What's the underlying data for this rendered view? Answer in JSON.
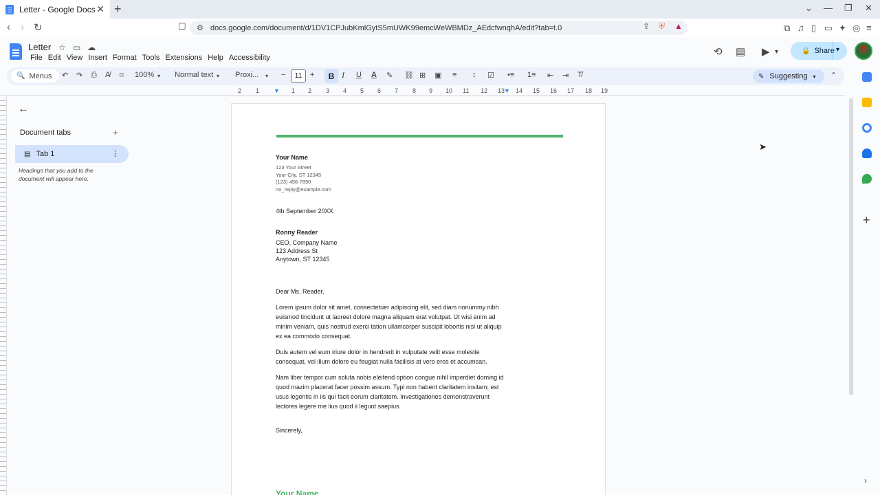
{
  "browser": {
    "tab_title": "Letter - Google Docs",
    "tab_close": "✕",
    "new_tab": "+",
    "url": "docs.google.com/document/d/1DV1CPJubKmlGytS5mUWK99emcWeWBMDz_AEdcfwnqhA/edit?tab=t.0",
    "window_controls": [
      "⌄",
      "—",
      "❐",
      "✕"
    ]
  },
  "docs_header": {
    "title": "Letter",
    "menus": [
      "File",
      "Edit",
      "View",
      "Insert",
      "Format",
      "Tools",
      "Extensions",
      "Help",
      "Accessibility"
    ],
    "share_label": "Share"
  },
  "toolbar": {
    "search_menus": "Menus",
    "zoom": "100%",
    "style": "Normal text",
    "font": "Proxi...",
    "font_size": "11",
    "bold": "B",
    "italic": "I",
    "underline": "U",
    "mode": "Suggesting"
  },
  "ruler_numbers": [
    "2",
    "1",
    "1",
    "2",
    "3",
    "4",
    "5",
    "6",
    "7",
    "8",
    "9",
    "10",
    "11",
    "12",
    "13",
    "14",
    "15",
    "16",
    "17",
    "18",
    "19"
  ],
  "side_panel": {
    "heading": "Document tabs",
    "tab_label": "Tab 1",
    "hint": "Headings that you add to the document will appear here."
  },
  "document": {
    "sender_name": "Your Name",
    "sender_lines": [
      "123 Your Street",
      "Your City, ST 12345",
      "(123) 456-7890",
      "no_reply@example.com"
    ],
    "date": "4th September 20XX",
    "recipient_name": "Ronny Reader",
    "recipient_lines": [
      "CEO, Company Name",
      "123 Address St",
      "Anytown, ST 12345"
    ],
    "salutation": "Dear Ms. Reader,",
    "paragraphs": [
      "Lorem ipsum dolor sit amet, consectetuer adipiscing elit, sed diam nonummy nibh euismod tincidunt ut laoreet dolore magna aliquam erat volutpat. Ut wisi enim ad minim veniam, quis nostrud exerci tation ullamcorper suscipit lobortis nisl ut aliquip ex ea commodo consequat.",
      "Duis autem vel eum iriure dolor in hendrerit in vulputate velit esse molestie consequat, vel illum dolore eu feugiat nulla facilisis at vero eros et accumsan.",
      "Nam liber tempor cum soluta nobis eleifend option congue nihil imperdiet doming id quod mazim placerat facer possim assum. Typi non habent claritatem insitam; est usus legentis in iis qui facit eorum claritatem. Investigationes demonstraverunt lectores legere me lius quod ii legunt saepius."
    ],
    "closing": "Sincerely,",
    "footer_name": "Your Name"
  },
  "colors": {
    "accent_green": "#4fb36c",
    "share_blue": "#c2e7ff",
    "docs_blue": "#4285f4"
  }
}
